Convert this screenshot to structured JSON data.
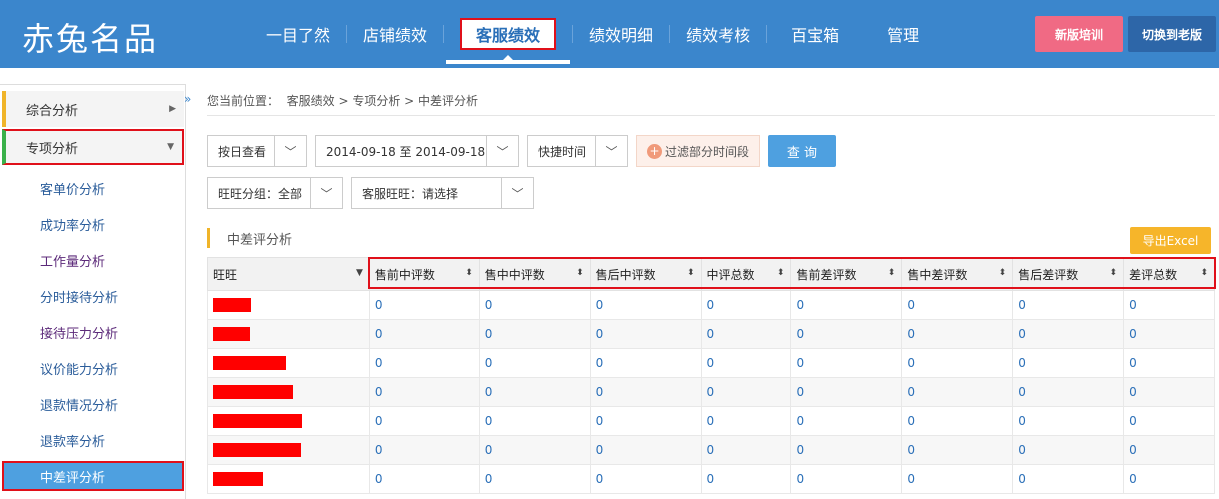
{
  "logo": "赤兔名品",
  "nav": [
    "一目了然",
    "店铺绩效",
    "客服绩效",
    "绩效明细",
    "绩效考核",
    "百宝箱",
    "管理"
  ],
  "nav_active_index": 2,
  "header_buttons": {
    "training": "新版培训",
    "switch_old": "切换到老版"
  },
  "sidebar": {
    "group1": "综合分析",
    "group2": "专项分析",
    "collapse_icon": "»",
    "items": [
      "客单价分析",
      "成功率分析",
      "工作量分析",
      "分时接待分析",
      "接待压力分析",
      "议价能力分析",
      "退款情况分析",
      "退款率分析"
    ],
    "active_item": "中差评分析"
  },
  "breadcrumb": {
    "prefix": "您当前位置：",
    "path": "客服绩效 > 专项分析 > 中差评分析"
  },
  "filters": {
    "view_mode": "按日查看",
    "date_range": "2014-09-18 至 2014-09-18",
    "quick_time": "快捷时间",
    "filter_period": "过滤部分时间段",
    "query": "查 询",
    "group": "旺旺分组：全部",
    "cs_wangwang": "客服旺旺：请选择"
  },
  "section_title": "中差评分析",
  "export": "导出Excel",
  "table": {
    "columns": [
      "旺旺",
      "售前中评数",
      "售中中评数",
      "售后中评数",
      "中评总数",
      "售前差评数",
      "售中差评数",
      "售后差评数",
      "差评总数"
    ],
    "rows": [
      [
        "0",
        "0",
        "0",
        "0",
        "0",
        "0",
        "0",
        "0"
      ],
      [
        "0",
        "0",
        "0",
        "0",
        "0",
        "0",
        "0",
        "0"
      ],
      [
        "0",
        "0",
        "0",
        "0",
        "0",
        "0",
        "0",
        "0"
      ],
      [
        "0",
        "0",
        "0",
        "0",
        "0",
        "0",
        "0",
        "0"
      ],
      [
        "0",
        "0",
        "0",
        "0",
        "0",
        "0",
        "0",
        "0"
      ],
      [
        "0",
        "0",
        "0",
        "0",
        "0",
        "0",
        "0",
        "0"
      ],
      [
        "0",
        "0",
        "0",
        "0",
        "0",
        "0",
        "0",
        "0"
      ]
    ]
  },
  "colors": {
    "topbar": "#3b86cc",
    "accent_red": "#e0101a",
    "link": "#2a6fb8",
    "export": "#f6b52a",
    "training": "#f06a84"
  }
}
